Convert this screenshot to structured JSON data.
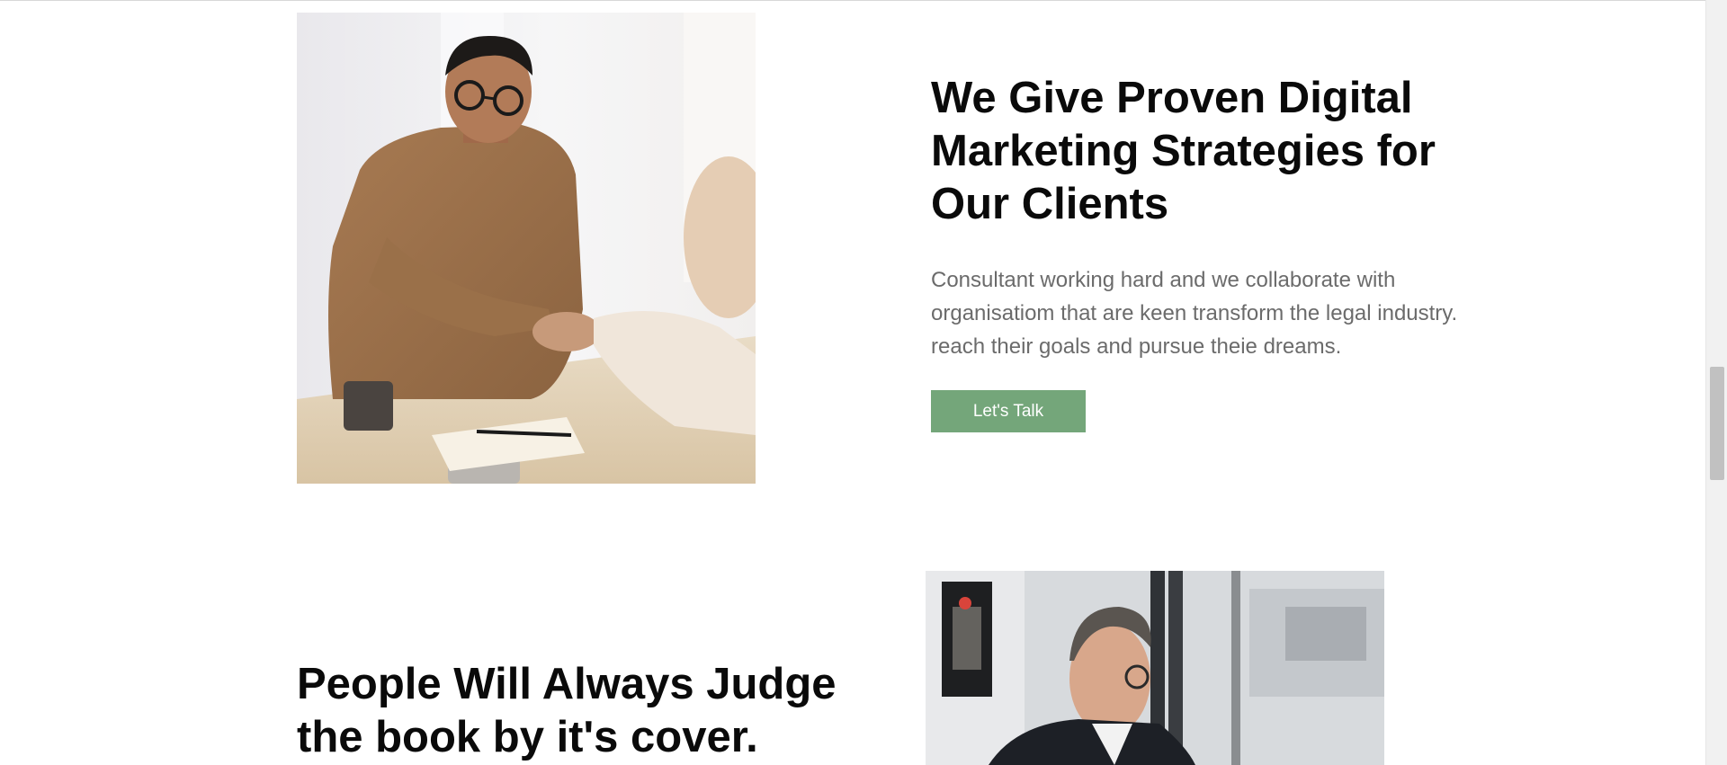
{
  "section_one": {
    "title": "We Give Proven Digital\nMarketing Strategies for\nOur Clients",
    "body": "Consultant working hard and we collaborate with\norganisatiom that are keen transform the legal industry.\nreach their goals and pursue theie dreams.",
    "cta_label": "Let's Talk",
    "image_alt": "handshake-meeting-photo"
  },
  "section_two": {
    "title": "People Will Always Judge\nthe book by it's cover.",
    "image_alt": "man-at-laptop-office-photo"
  },
  "colors": {
    "cta_background": "#74a67a",
    "heading": "#0a0a0a",
    "body_text": "#6b6b6b"
  }
}
